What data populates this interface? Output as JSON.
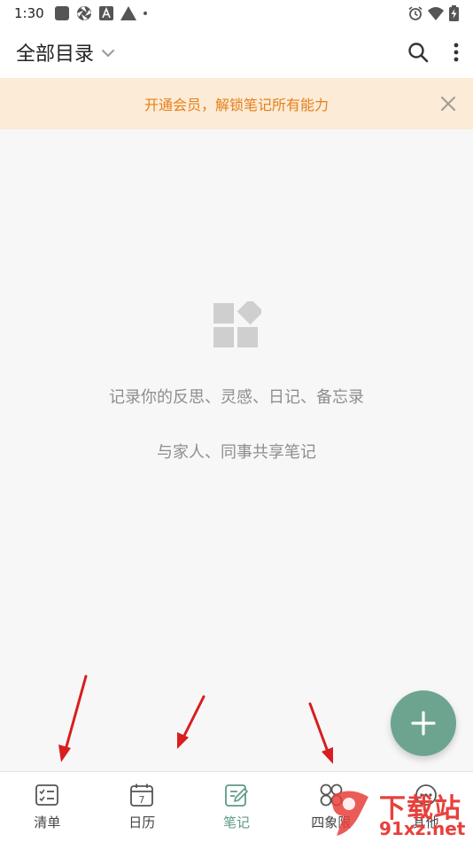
{
  "status_bar": {
    "time": "1:30",
    "left_icons": [
      "app-square-icon",
      "aperture-icon",
      "font-a-icon",
      "warning-triangle-icon",
      "dot-icon"
    ],
    "right_icons": [
      "alarm-icon",
      "wifi-icon",
      "battery-charging-icon"
    ]
  },
  "app_bar": {
    "title": "全部目录",
    "actions": [
      "search-icon",
      "more-vert-icon"
    ]
  },
  "promo": {
    "text": "开通会员，解锁笔记所有能力"
  },
  "empty_state": {
    "icon": "widgets-icon",
    "line1": "记录你的反思、灵感、日记、备忘录",
    "line2": "与家人、同事共享笔记"
  },
  "fab": {
    "icon": "plus-icon"
  },
  "bottom_nav": {
    "items": [
      {
        "label": "清单",
        "icon": "checklist-icon",
        "active": false
      },
      {
        "label": "日历",
        "icon": "calendar-icon",
        "active": false,
        "day": "7"
      },
      {
        "label": "笔记",
        "icon": "note-edit-icon",
        "active": true
      },
      {
        "label": "四象限",
        "icon": "quadrant-icon",
        "active": false
      },
      {
        "label": "其他",
        "icon": "other-icon",
        "active": false
      }
    ]
  },
  "watermark": {
    "title": "下载站",
    "site": "91xz.net"
  },
  "colors": {
    "accent": "#6da48f",
    "promo_bg": "#fcebd6",
    "promo_text": "#e57f1a",
    "annotation_arrow": "#d81e1e"
  }
}
